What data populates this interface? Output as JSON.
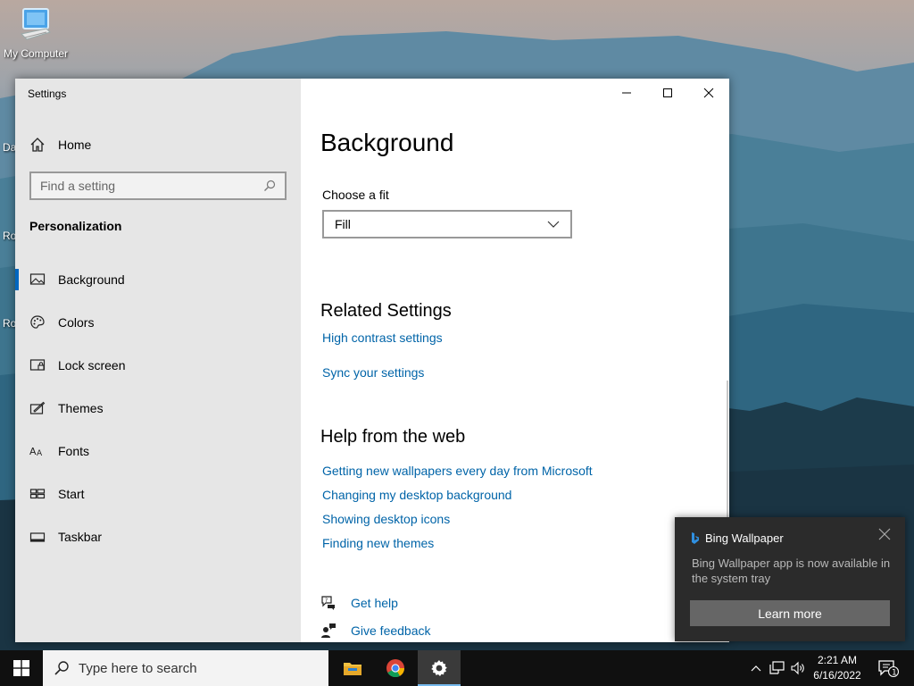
{
  "desktop": {
    "icon_label": "My Computer",
    "clipped_labels": [
      "Da",
      "Ro",
      "Ro"
    ]
  },
  "window": {
    "title": "Settings",
    "controls": [
      "minimize",
      "maximize",
      "close"
    ]
  },
  "sidebar": {
    "home_label": "Home",
    "search_placeholder": "Find a setting",
    "section_title": "Personalization",
    "items": [
      {
        "label": "Background",
        "icon": "picture-icon",
        "active": true
      },
      {
        "label": "Colors",
        "icon": "palette-icon",
        "active": false
      },
      {
        "label": "Lock screen",
        "icon": "lock-screen-icon",
        "active": false
      },
      {
        "label": "Themes",
        "icon": "themes-icon",
        "active": false
      },
      {
        "label": "Fonts",
        "icon": "fonts-icon",
        "active": false
      },
      {
        "label": "Start",
        "icon": "start-icon",
        "active": false
      },
      {
        "label": "Taskbar",
        "icon": "taskbar-icon",
        "active": false
      }
    ]
  },
  "content": {
    "title": "Background",
    "fit_label": "Choose a fit",
    "fit_value": "Fill",
    "related_title": "Related Settings",
    "related_links": [
      "High contrast settings",
      "Sync your settings"
    ],
    "help_title": "Help from the web",
    "help_links": [
      "Getting new wallpapers every day from Microsoft",
      "Changing my desktop background",
      "Showing desktop icons",
      "Finding new themes"
    ],
    "get_help": "Get help",
    "give_feedback": "Give feedback"
  },
  "toast": {
    "app_name": "Bing Wallpaper",
    "message": "Bing Wallpaper app is now available in the system tray",
    "button": "Learn more"
  },
  "taskbar": {
    "search_placeholder": "Type here to search",
    "time": "2:21 AM",
    "date": "6/16/2022",
    "notification_count": "1"
  },
  "colors": {
    "accent": "#0067c0",
    "link": "#0064a8",
    "sidebar_bg": "#e6e6e6",
    "taskbar_bg": "#101010",
    "toast_bg": "#2b2b2b"
  }
}
